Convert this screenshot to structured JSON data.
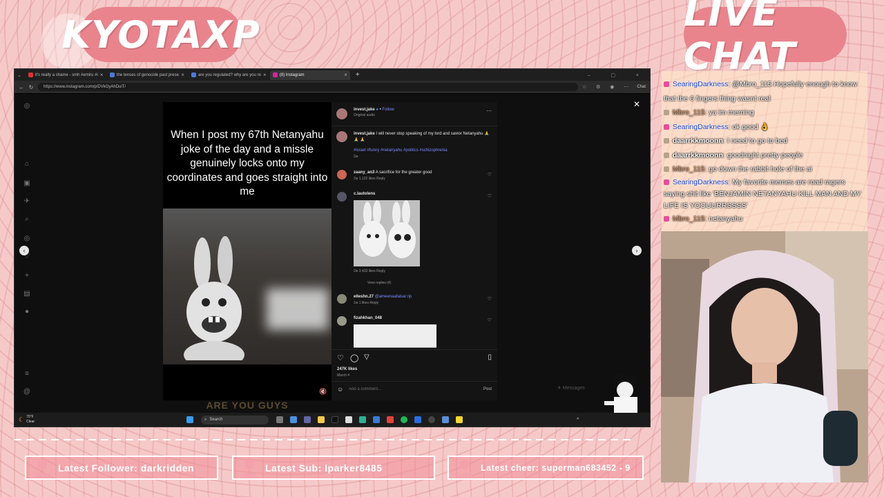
{
  "overlay": {
    "left_title": "KYOTAXP",
    "right_title": "LIVE CHAT"
  },
  "browser": {
    "tabs": [
      {
        "label": "it's really a shame - smh #emiru #i"
      },
      {
        "label": "the tenses of genocide past prese"
      },
      {
        "label": "are you regulated? why are you re"
      },
      {
        "label": "(8) Instagram"
      }
    ],
    "url": "https://www.instagram.com/p/DVkGyAhDuiT/",
    "chat_button": "Chat"
  },
  "post": {
    "meme_text": "When I post my 67th Netanyahu joke of the day and a missle genuinely locks onto my coordinates and goes straight into me",
    "caption_strip": "ARE YOU GUYS",
    "author": "invest.jake",
    "follow": "Follow",
    "audio": "Original audio",
    "caption_text": "I will never stop speaking of my lord and savior Netanyahu 🙏 🙏 🙏",
    "hashtags": "#israel #funny #netanyahu #politics #schizophrenia",
    "caption_age": "2w",
    "comments": [
      {
        "user": "zaany_an3",
        "text": "A sacrifice for the greater good",
        "meta": "2w   1,122 likes   Reply"
      },
      {
        "user": "c.lautolens",
        "text": "",
        "meta": "2w   3,433 likes   Reply",
        "view_replies": "View replies (4)"
      },
      {
        "user": "elleshn.27",
        "text": "@ameenaafaisal rip",
        "meta": "1w   1 likes   Reply"
      },
      {
        "user": "fizahkhan_048",
        "text": "",
        "meta": ""
      }
    ],
    "likes": "247K likes",
    "date": "March 4",
    "comment_placeholder": "Add a comment...",
    "post_button": "Post",
    "messages": "Messages"
  },
  "taskbar": {
    "weather_temp": "70°F",
    "weather_desc": "Clear",
    "search": "Search"
  },
  "chat": {
    "messages": [
      {
        "user": "SearingDarkness",
        "color": "blue",
        "text": ": @Mbro_115 Hopefully enough to know that the 6 fingers thing wasnt real",
        "badge": "pink"
      },
      {
        "user": "Mbro_115",
        "color": "orange",
        "text": ": ya im meming",
        "badge": "grey"
      },
      {
        "user": "SearingDarkness",
        "color": "blue",
        "text": ": ok good 👌",
        "badge": "pink"
      },
      {
        "user": "daarrkkmoonn",
        "color": "white",
        "text": ": I need to go to bed",
        "badge": "grey"
      },
      {
        "user": "daarrkkmoonn",
        "color": "white",
        "text": ": goodnight pretty people",
        "badge": "grey"
      },
      {
        "user": "Mbro_115",
        "color": "orange",
        "text": ": go down the rabbit hole of the ai",
        "badge": "grey"
      },
      {
        "user": "SearingDarkness",
        "color": "blue",
        "text": ": My favorite memes are road ragers saying shit like 'BENJAMIN NETANYAHU KILL MAN AND MY LIFE IS YOOUURRSSSS'",
        "badge": "pink"
      },
      {
        "user": "Mbro_115",
        "color": "orange",
        "text": ": netanyahu",
        "badge": "pink"
      }
    ]
  },
  "alerts": {
    "follower": "Latest Follower: darkridden",
    "sub": "Latest Sub: lparker8485",
    "cheer": "Latest cheer: superman683452 - 9"
  },
  "colors": {
    "overlay_pink": "#e9848d",
    "background": "#f6c9c9",
    "instagram_link": "#7c8cff"
  }
}
